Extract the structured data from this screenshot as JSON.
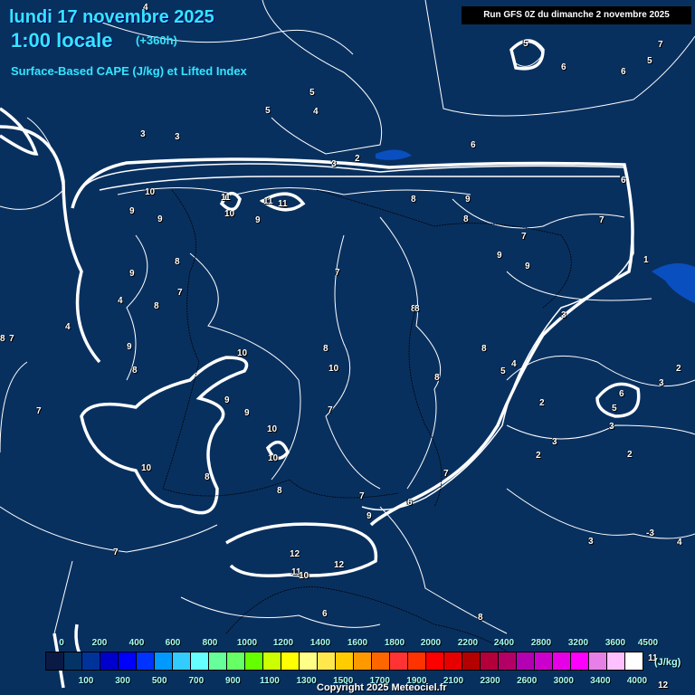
{
  "header": {
    "date": "lundi 17 novembre 2025",
    "time": "1:00 locale",
    "lead": "(+360h)",
    "parameter": "Surface-Based CAPE (J/kg) et Lifted Index",
    "run": "Run GFS 0Z du dimanche 2 novembre 2025"
  },
  "contour_labels": [
    "4",
    "3",
    "3",
    "5",
    "4",
    "5",
    "2",
    "3",
    "10",
    "9",
    "9",
    "11",
    "10",
    "11",
    "11",
    "9",
    "8",
    "9",
    "8",
    "8",
    "9",
    "7",
    "4",
    "8",
    "9",
    "10",
    "8",
    "8",
    "10",
    "9",
    "9",
    "10",
    "10",
    "8",
    "7",
    "7",
    "8",
    "8",
    "8",
    "9",
    "9",
    "10",
    "7",
    "8",
    "7",
    "5",
    "4",
    "3",
    "2",
    "6",
    "2",
    "3",
    "3",
    "2",
    "3",
    "5",
    "6",
    "6",
    "7",
    "7",
    "1",
    "4",
    "2",
    "9",
    "6",
    "7",
    "12",
    "12",
    "11",
    "10",
    "6",
    "7",
    "8",
    "3",
    "-3",
    "4",
    "7",
    "8",
    "8",
    "5",
    "6",
    "6",
    "5",
    "7",
    "12",
    "11"
  ],
  "legend": {
    "colors": [
      "#0b1a45",
      "#043466",
      "#003399",
      "#0000cc",
      "#0000ff",
      "#0033ff",
      "#0099ff",
      "#33ccff",
      "#66ffff",
      "#66ff99",
      "#66ff66",
      "#66ff00",
      "#ccff00",
      "#ffff00",
      "#ffff88",
      "#ffe84d",
      "#ffcc00",
      "#ff9900",
      "#ff6600",
      "#ff3333",
      "#ff3300",
      "#ff0000",
      "#e60000",
      "#b30000",
      "#b3003b",
      "#b30066",
      "#b300b3",
      "#cc00cc",
      "#e600e6",
      "#ff00ff",
      "#e680e6",
      "#ffc0ff",
      "#ffffff"
    ],
    "top_ticks": [
      "0",
      "200",
      "400",
      "600",
      "800",
      "1000",
      "1200",
      "1400",
      "1600",
      "1800",
      "2000",
      "2200",
      "2400",
      "2800",
      "3200",
      "3600",
      "4500"
    ],
    "bottom_ticks": [
      "100",
      "300",
      "500",
      "700",
      "900",
      "1100",
      "1300",
      "1500",
      "1700",
      "1900",
      "2100",
      "2300",
      "2600",
      "3000",
      "3400",
      "4000"
    ],
    "unit": "(J/kg)"
  },
  "copyright": "Copyright 2025 Meteociel.fr"
}
